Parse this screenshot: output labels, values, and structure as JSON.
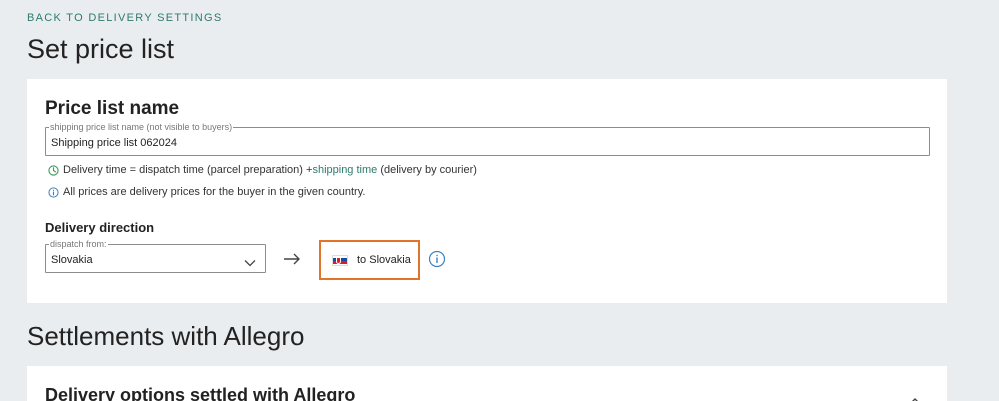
{
  "back_link": "BACK TO DELIVERY SETTINGS",
  "page_title": "Set price list",
  "price_list": {
    "title": "Price list name",
    "name_field": {
      "legend": "shipping price list name (not visible to buyers)",
      "value": "Shipping price list 062024"
    },
    "note_delivery_time": {
      "icon": "clock-icon",
      "prefix": "Delivery time = dispatch time (parcel preparation) +",
      "link": "shipping time",
      "suffix": " (delivery by courier)"
    },
    "note_prices": {
      "icon": "info-icon",
      "text": "All prices are delivery prices for the buyer in the given country."
    },
    "delivery_direction": {
      "label": "Delivery direction",
      "dispatch_from": {
        "legend": "dispatch from:",
        "value": "Slovakia"
      },
      "arrow_icon": "arrow-right-icon",
      "destination": {
        "flag": "slovakia-flag-icon",
        "label": "to Slovakia"
      },
      "info_icon": "info-circle-icon"
    }
  },
  "settlements": {
    "title": "Settlements with Allegro",
    "card_title": "Delivery options settled with Allegro",
    "collapse_icon": "chevron-up-icon"
  },
  "colors": {
    "accent": "#2d7a6e",
    "highlight_border": "#e0742b",
    "background": "#eaedf0"
  }
}
